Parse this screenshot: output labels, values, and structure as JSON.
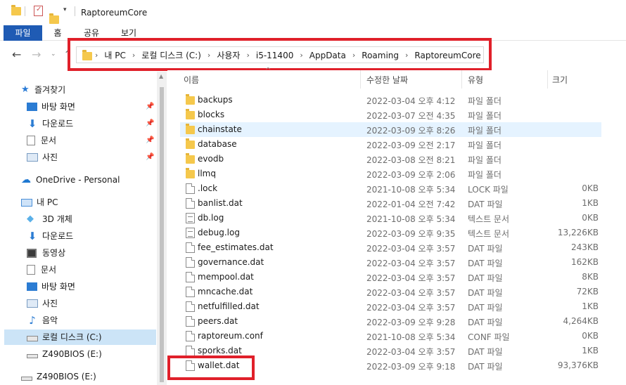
{
  "window": {
    "title": "RaptoreumCore"
  },
  "ribbon": {
    "tabs": [
      "파일",
      "홈",
      "공유",
      "보기"
    ]
  },
  "address": {
    "crumbs": [
      "내 PC",
      "로컬 디스크 (C:)",
      "사용자",
      "i5-11400",
      "AppData",
      "Roaming",
      "RaptoreumCore"
    ]
  },
  "sidebar": {
    "quick_access": "즐겨찾기",
    "quick_items": [
      "바탕 화면",
      "다운로드",
      "문서",
      "사진"
    ],
    "onedrive": "OneDrive - Personal",
    "this_pc": "내 PC",
    "pc_items": [
      "3D 개체",
      "다운로드",
      "동영상",
      "문서",
      "바탕 화면",
      "사진",
      "음악",
      "로컬 디스크 (C:)",
      "Z490BIOS (E:)"
    ],
    "drive2": "Z490BIOS (E:)"
  },
  "columns": {
    "name": "이름",
    "date": "수정한 날짜",
    "type": "유형",
    "size": "크기"
  },
  "files": [
    {
      "name": "backups",
      "date": "2022-03-04 오후 4:12",
      "type": "파일 폴더",
      "size": "",
      "icon": "folder-icon"
    },
    {
      "name": "blocks",
      "date": "2022-03-07 오전 4:35",
      "type": "파일 폴더",
      "size": "",
      "icon": "folder-icon"
    },
    {
      "name": "chainstate",
      "date": "2022-03-09 오후 8:26",
      "type": "파일 폴더",
      "size": "",
      "icon": "folder-icon"
    },
    {
      "name": "database",
      "date": "2022-03-09 오전 2:17",
      "type": "파일 폴더",
      "size": "",
      "icon": "folder-icon"
    },
    {
      "name": "evodb",
      "date": "2022-03-08 오전 8:21",
      "type": "파일 폴더",
      "size": "",
      "icon": "folder-icon"
    },
    {
      "name": "llmq",
      "date": "2022-03-09 오후 2:06",
      "type": "파일 폴더",
      "size": "",
      "icon": "folder-icon"
    },
    {
      "name": ".lock",
      "date": "2021-10-08 오후 5:34",
      "type": "LOCK 파일",
      "size": "0KB",
      "icon": "file-icon"
    },
    {
      "name": "banlist.dat",
      "date": "2022-01-04 오전 7:42",
      "type": "DAT 파일",
      "size": "1KB",
      "icon": "file-icon"
    },
    {
      "name": "db.log",
      "date": "2021-10-08 오후 5:34",
      "type": "텍스트 문서",
      "size": "0KB",
      "icon": "text-file-icon"
    },
    {
      "name": "debug.log",
      "date": "2022-03-09 오후 9:35",
      "type": "텍스트 문서",
      "size": "13,226KB",
      "icon": "text-file-icon"
    },
    {
      "name": "fee_estimates.dat",
      "date": "2022-03-04 오후 3:57",
      "type": "DAT 파일",
      "size": "243KB",
      "icon": "file-icon"
    },
    {
      "name": "governance.dat",
      "date": "2022-03-04 오후 3:57",
      "type": "DAT 파일",
      "size": "162KB",
      "icon": "file-icon"
    },
    {
      "name": "mempool.dat",
      "date": "2022-03-04 오후 3:57",
      "type": "DAT 파일",
      "size": "8KB",
      "icon": "file-icon"
    },
    {
      "name": "mncache.dat",
      "date": "2022-03-04 오후 3:57",
      "type": "DAT 파일",
      "size": "72KB",
      "icon": "file-icon"
    },
    {
      "name": "netfulfilled.dat",
      "date": "2022-03-04 오후 3:57",
      "type": "DAT 파일",
      "size": "1KB",
      "icon": "file-icon"
    },
    {
      "name": "peers.dat",
      "date": "2022-03-09 오후 9:28",
      "type": "DAT 파일",
      "size": "4,264KB",
      "icon": "file-icon"
    },
    {
      "name": "raptoreum.conf",
      "date": "2021-10-08 오후 5:34",
      "type": "CONF 파일",
      "size": "0KB",
      "icon": "file-icon"
    },
    {
      "name": "sporks.dat",
      "date": "2022-03-04 오후 3:57",
      "type": "DAT 파일",
      "size": "1KB",
      "icon": "file-icon"
    },
    {
      "name": "wallet.dat",
      "date": "2022-03-09 오후 9:18",
      "type": "DAT 파일",
      "size": "93,376KB",
      "icon": "file-icon"
    }
  ],
  "colors": {
    "accent": "#1f5bb4",
    "highlight": "#e0202a",
    "folder": "#f5c84c",
    "selected_row": "#e5f3ff"
  }
}
